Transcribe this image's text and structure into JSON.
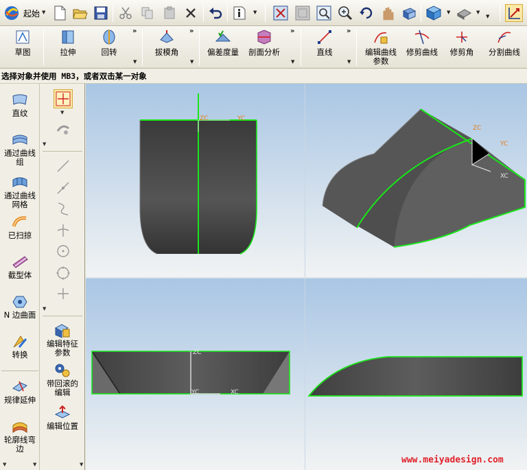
{
  "toolbar": {
    "start_label": "起始",
    "icons": [
      "logo-icon",
      "new-file-icon",
      "open-folder-icon",
      "save-icon",
      "cut-icon",
      "copy-icon",
      "paste-icon",
      "delete-icon",
      "undo-icon",
      "info-icon",
      "fit-view-icon",
      "zoom-window-icon",
      "zoom-box-icon",
      "zoom-icon",
      "rotate-icon",
      "pan-icon",
      "orient-icon",
      "render-cube-icon",
      "shading-icon",
      "select-icon"
    ]
  },
  "ribbon": {
    "items": [
      {
        "label": "草图"
      },
      {
        "label": "拉伸"
      },
      {
        "label": "回转"
      },
      {
        "label": "拔模角"
      },
      {
        "label": "偏差度量"
      },
      {
        "label": "剖面分析"
      },
      {
        "label": "直线"
      },
      {
        "label": "编辑曲线"
      },
      {
        "label": "参数"
      },
      {
        "label": "修剪曲线"
      },
      {
        "label": "修剪角"
      },
      {
        "label": "分割曲线"
      }
    ],
    "more": "»"
  },
  "status": {
    "prompt": "选择对象并使用 MB3，或者双击某一对象"
  },
  "left_panel": {
    "items": [
      {
        "label": "直纹"
      },
      {
        "label": "通过曲线"
      },
      {
        "label": "组"
      },
      {
        "label": "通过曲线"
      },
      {
        "label": "网格"
      },
      {
        "label": "已扫掠"
      },
      {
        "label": "截型体"
      },
      {
        "label": "N 边曲面"
      },
      {
        "label": "转换"
      },
      {
        "label": "规律延伸"
      },
      {
        "label": "轮廓线弯"
      },
      {
        "label": "边"
      }
    ]
  },
  "mid_panel": {
    "items": [
      {
        "label": "编辑特征"
      },
      {
        "label": "参数"
      },
      {
        "label": "带回滚的"
      },
      {
        "label": "编辑"
      },
      {
        "label": "编辑位置"
      }
    ]
  },
  "viewport": {
    "axis_labels": {
      "zc": "ZC",
      "yc": "YC",
      "xc": "XC"
    },
    "colors": {
      "bg_top": "#a9c6e4",
      "bg_bottom": "#f2f4f4",
      "edge": "#19e619",
      "solid": "#4a4a4a"
    }
  },
  "watermark": "www.meiyadesign.com"
}
